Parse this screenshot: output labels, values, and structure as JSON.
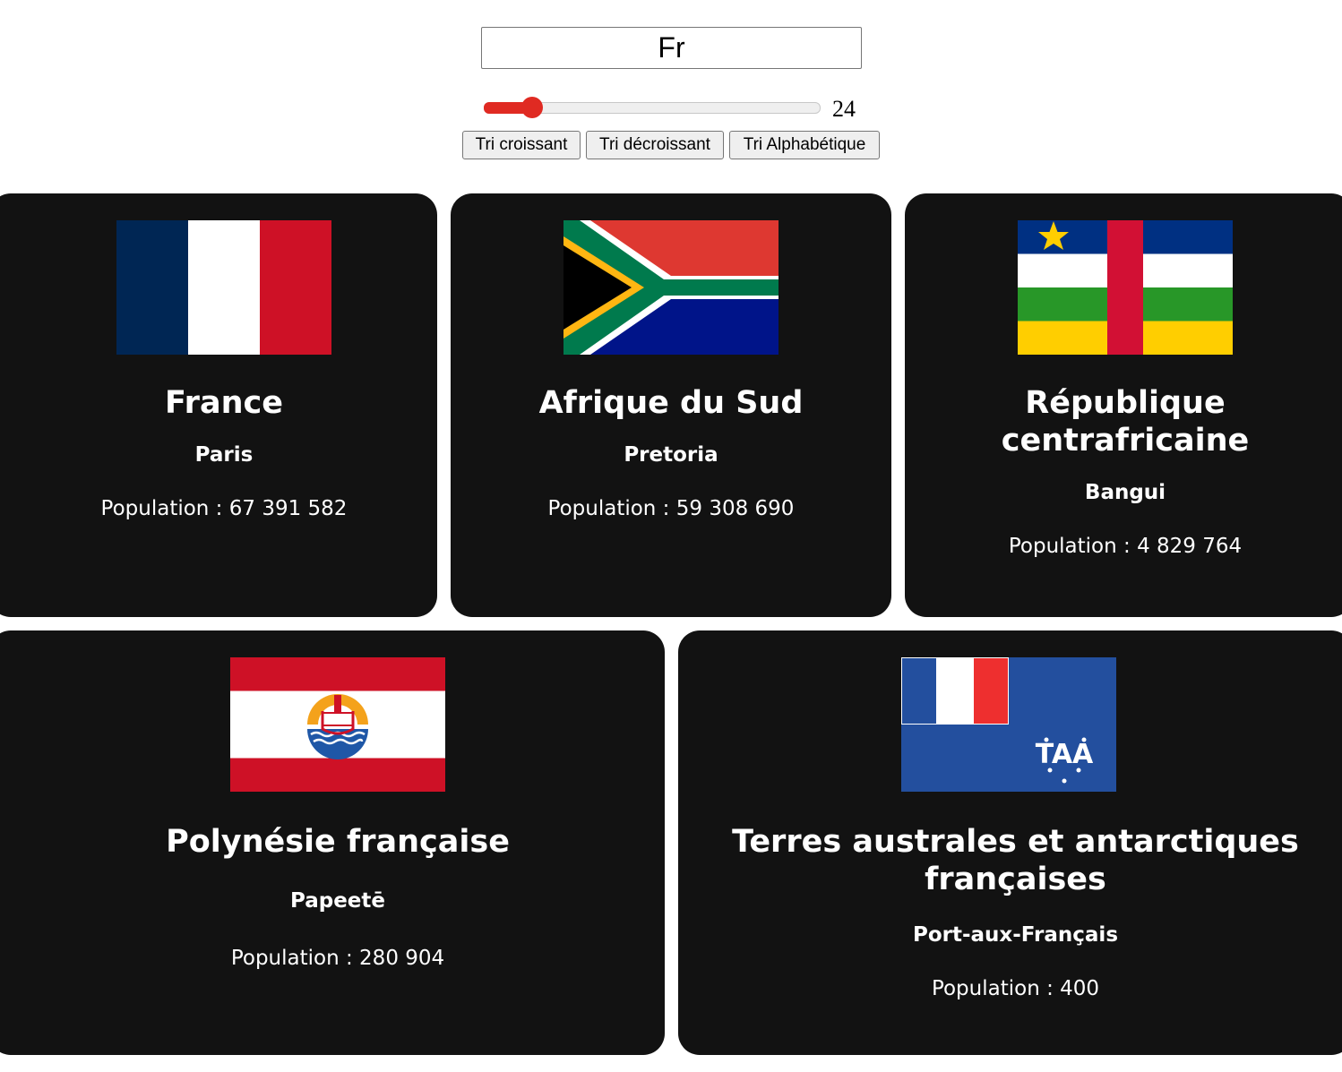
{
  "search": {
    "value": "Fr"
  },
  "slider": {
    "value": "24",
    "min": 1,
    "max": 250,
    "fraction": 0.12
  },
  "sort_buttons": {
    "ascending": "Tri croissant",
    "descending": "Tri décroissant",
    "alphabetical": "Tri Alphabétique"
  },
  "population_label": "Population :",
  "countries": [
    {
      "name": "France",
      "capital": "Paris",
      "population": "67 391 582",
      "flag": "france-flag"
    },
    {
      "name": "Afrique du Sud",
      "capital": "Pretoria",
      "population": "59 308 690",
      "flag": "south-africa-flag"
    },
    {
      "name": "République centrafricaine",
      "capital": "Bangui",
      "population": "4 829 764",
      "flag": "central-african-republic-flag"
    },
    {
      "name": "Polynésie française",
      "capital": "Papeetē",
      "population": "280 904",
      "flag": "french-polynesia-flag"
    },
    {
      "name": "Terres australes et antarctiques françaises",
      "capital": "Port-aux-Français",
      "population": "400",
      "flag": "french-southern-territories-flag"
    }
  ],
  "colors": {
    "card_background": "#121212",
    "slider_accent": "#e02a22"
  }
}
